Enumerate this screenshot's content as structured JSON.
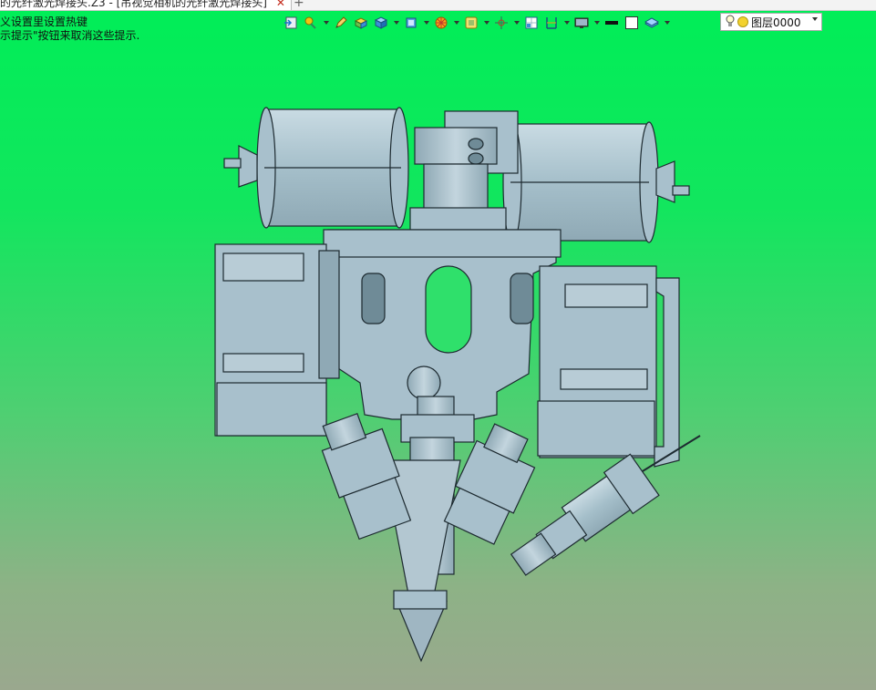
{
  "tab": {
    "title": "的光纤激光焊接头.Z3 - [吊视觉相机的光纤激光焊接头]",
    "close": "✕",
    "new": "+"
  },
  "hint": {
    "line1": "义设置里设置热键",
    "line2": "示提示\"按钮来取消这些提示."
  },
  "toolbar": {
    "icons": [
      "import-icon",
      "wrench-icon",
      "pencil-icon",
      "box-icon",
      "cube-icon",
      "view-cube-icon",
      "render-icon",
      "shade-icon",
      "axis-icon",
      "grid-icon",
      "align-icon",
      "display-icon",
      "line-icon",
      "color-swatch-icon",
      "layer-stack-icon"
    ]
  },
  "layer": {
    "name": "图层0000"
  },
  "colors": {
    "bg_top": "#00ee57",
    "bg_bottom": "#9aa88e",
    "metal": "#a8c0cc"
  }
}
